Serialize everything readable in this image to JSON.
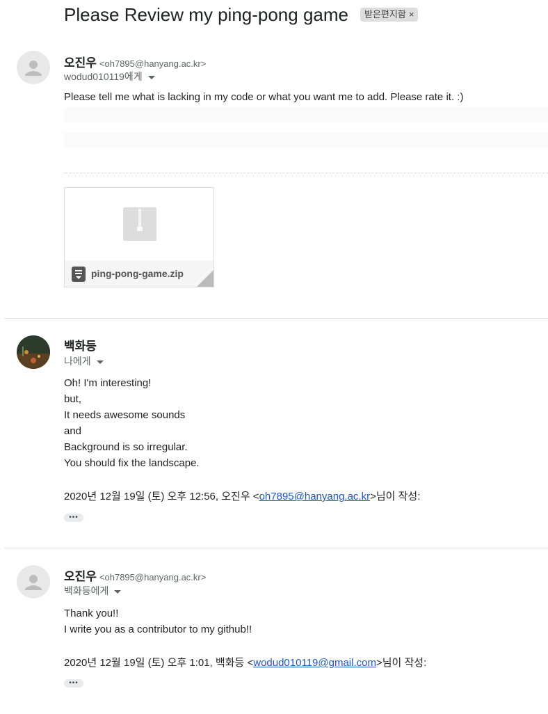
{
  "thread": {
    "subject": "Please Review my ping-pong game",
    "label": "받은편지함",
    "label_remove": "×"
  },
  "messages": [
    {
      "sender_name": "오진우",
      "sender_email": "<oh7895@hanyang.ac.kr>",
      "recipient": "wodud010119에게",
      "body": "Please tell me what is lacking in my code or what you want me to add. Please rate it. :)",
      "attachment": {
        "filename": "ping-pong-game.zip",
        "icon": "zip-archive-icon"
      }
    },
    {
      "sender_name": "백화등",
      "recipient": "나에게",
      "body_lines": [
        "Oh! I'm interesting!",
        "but,",
        "It needs awesome sounds",
        "and",
        "Background is so irregular.",
        "You should fix the landscape."
      ],
      "quote_prefix": "2020년 12월 19일 (토) 오후 12:56, 오진우 <",
      "quote_email": "oh7895@hanyang.ac.kr",
      "quote_suffix": ">님이 작성:",
      "show_trimmed": "•••"
    },
    {
      "sender_name": "오진우",
      "sender_email": "<oh7895@hanyang.ac.kr>",
      "recipient": "백화등에게",
      "body_lines": [
        "Thank you!!",
        "I write you as a contributor to my github!!"
      ],
      "quote_prefix": "2020년 12월 19일 (토) 오후 1:01, 백화등 <",
      "quote_email": "wodud010119@gmail.com",
      "quote_suffix": ">님이 작성:",
      "show_trimmed": "•••"
    }
  ]
}
